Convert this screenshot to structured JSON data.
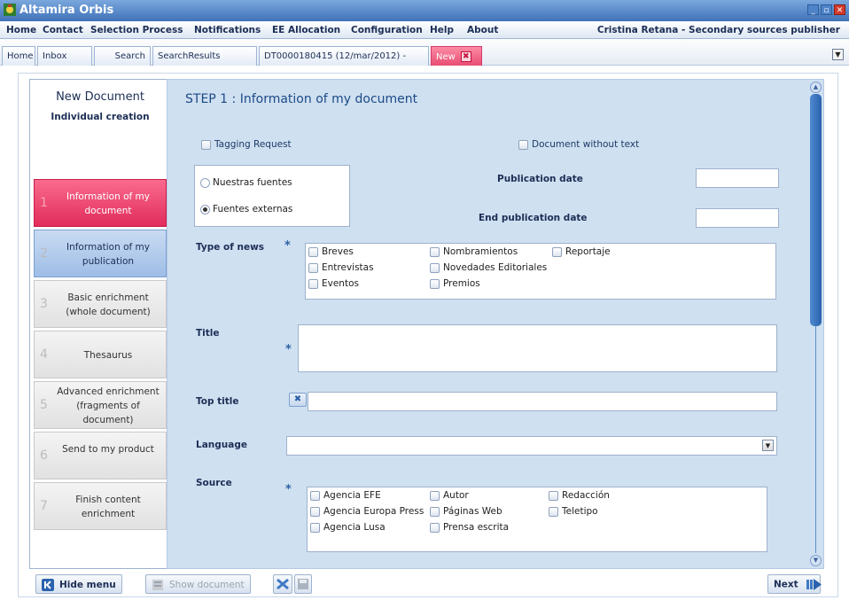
{
  "window": {
    "title": "Altamira Orbis",
    "buttons": [
      "minimize",
      "maximize",
      "close"
    ]
  },
  "menu": {
    "items": [
      "Home",
      "Contact",
      "Selection Process",
      "Notifications",
      "EE Allocation",
      "Configuration",
      "Help",
      "About"
    ],
    "user": "Cristina Retana - Secondary sources publisher"
  },
  "tabs": [
    {
      "label": "Home"
    },
    {
      "label": "Inbox"
    },
    {
      "label": "Search"
    },
    {
      "label": "SearchResults"
    },
    {
      "label": "DT0000180415 (12/mar/2012) -"
    },
    {
      "label": "New",
      "active": true
    }
  ],
  "sidebar": {
    "title": "New Document",
    "subtitle": "Individual creation",
    "steps": [
      {
        "num": "1",
        "label": "Information of my document",
        "state": "active"
      },
      {
        "num": "2",
        "label": "Information of my publication",
        "state": "next"
      },
      {
        "num": "3",
        "label": "Basic enrichment (whole document)"
      },
      {
        "num": "4",
        "label": "Thesaurus"
      },
      {
        "num": "5",
        "label": "Advanced enrichment (fragments of document)"
      },
      {
        "num": "6",
        "label": "Send to my product"
      },
      {
        "num": "7",
        "label": "Finish content enrichment"
      }
    ]
  },
  "form": {
    "step_title": "STEP 1 : Information of my document",
    "tagging_request": "Tagging Request",
    "document_without_text": "Document without text",
    "sources_radio": [
      {
        "label": "Nuestras fuentes",
        "checked": false
      },
      {
        "label": "Fuentes externas",
        "checked": true
      }
    ],
    "publication_date_label": "Publication date",
    "publication_date_value": "",
    "end_publication_date_label": "End publication date",
    "end_publication_date_value": "",
    "type_of_news_label": "Type of news",
    "required_mark": "*",
    "type_of_news_options": [
      "Breves",
      "Nombramientos",
      "Reportaje",
      "Entrevistas",
      "Novedades Editoriales",
      "Eventos",
      "Premios"
    ],
    "title_label": "Title",
    "title_value": "",
    "top_title_label": "Top title",
    "top_title_value": "",
    "clear_icon": "✖",
    "language_label": "Language",
    "language_value": "",
    "source_label": "Source",
    "source_options": [
      "Agencia EFE",
      "Autor",
      "Redacción",
      "Agencia Europa Press",
      "Páginas Web",
      "Teletipo",
      "Agencia Lusa",
      "Prensa escrita"
    ]
  },
  "footer": {
    "hide_menu": "Hide menu",
    "show_document": "Show document",
    "next": "Next"
  },
  "colors": {
    "active_step": "#e12c5b",
    "next_step": "#9ebde6",
    "content_bg": "#cfe0f1",
    "accent": "#2a62ad"
  },
  "icons": [
    "app-logo-icon",
    "tab-close-icon",
    "tabs-dropdown-icon",
    "clear-icon",
    "select-arrow-icon",
    "hide-menu-icon",
    "show-document-icon",
    "tools-icon",
    "save-icon",
    "next-arrow-icon"
  ]
}
